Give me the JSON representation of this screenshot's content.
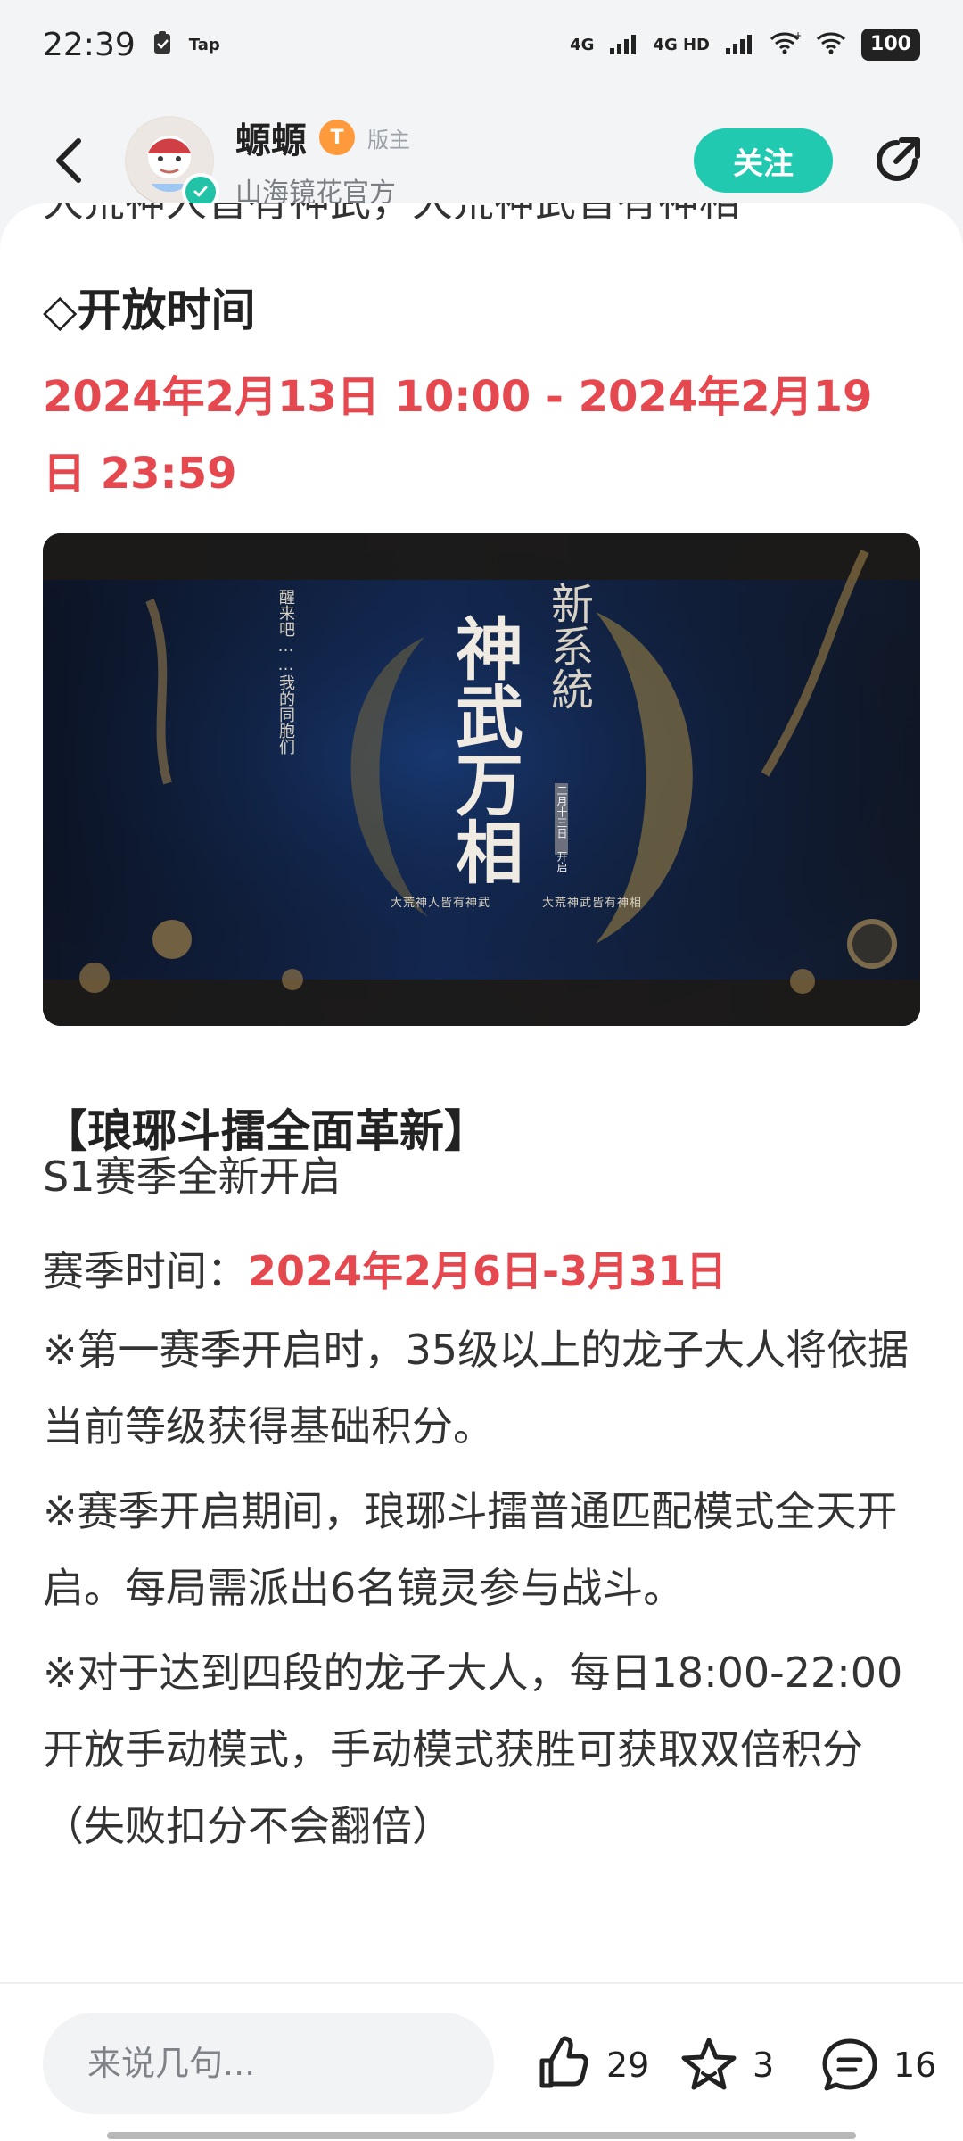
{
  "status_bar": {
    "time": "22:39",
    "tap": "Tap",
    "signal_1": "4G",
    "signal_2": "4G HD",
    "battery": "100"
  },
  "header": {
    "username": "螈螈",
    "level": "T",
    "role": "版主",
    "subtitle": "山海镜花官方",
    "follow_label": "关注"
  },
  "content": {
    "cut_line": "大荒神人皆有神武，大荒神武皆有神相",
    "opening_title": "◇开放时间",
    "opening_time": "2024年2月13日 10:00 - 2024年2月19日 23:59",
    "banner": {
      "vertical_text_left": "醒来吧……我的同胞们",
      "vertical_text_right_small": "二月十三日 开启",
      "small_label_1": "大荒神人皆有神武",
      "small_label_2": "大荒神武皆有神相",
      "new_system": "新系統",
      "main_title": "神武万相"
    },
    "section_title": "【琅琊斗擂全面革新】",
    "season_start": "S1赛季全新开启",
    "season_label": "赛季时间：",
    "season_time": "2024年2月6日-3月31日",
    "notes": [
      "※第一赛季开启时，35级以上的龙子大人将依据当前等级获得基础积分。",
      "※赛季开启期间，琅琊斗擂普通匹配模式全天开启。每局需派出6名镜灵参与战斗。",
      "※对于达到四段的龙子大人，每日18:00-22:00开放手动模式，手动模式获胜可获取双倍积分（失败扣分不会翻倍）"
    ]
  },
  "bottom_bar": {
    "comment_placeholder": "来说几句...",
    "likes": "29",
    "favorites": "3",
    "comments": "16"
  }
}
